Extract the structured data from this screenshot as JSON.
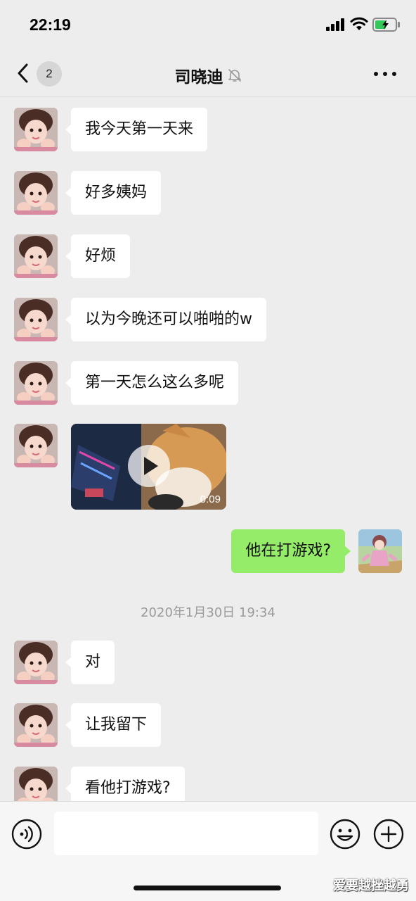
{
  "status_bar": {
    "time": "22:19"
  },
  "nav": {
    "back_badge": "2",
    "title": "司晓迪"
  },
  "messages": [
    {
      "side": "in",
      "text": "我今天第一天来"
    },
    {
      "side": "in",
      "text": "好多姨妈"
    },
    {
      "side": "in",
      "text": "好烦"
    },
    {
      "side": "in",
      "text": "以为今晚还可以啪啪的w"
    },
    {
      "side": "in",
      "text": "第一天怎么这么多呢"
    },
    {
      "side": "in",
      "type": "video",
      "duration": "0:09"
    },
    {
      "side": "out",
      "text": "他在打游戏?"
    },
    {
      "side": "in",
      "text": "对"
    },
    {
      "side": "in",
      "text": "让我留下"
    },
    {
      "side": "in",
      "text": "看他打游戏?"
    }
  ],
  "timestamp": "2020年1月30日 19:34",
  "input": {
    "placeholder": ""
  },
  "watermark": "爱要越挫越勇",
  "colors": {
    "outgoing_bubble": "#95ec69",
    "incoming_bubble": "#ffffff",
    "background": "#ededed"
  }
}
